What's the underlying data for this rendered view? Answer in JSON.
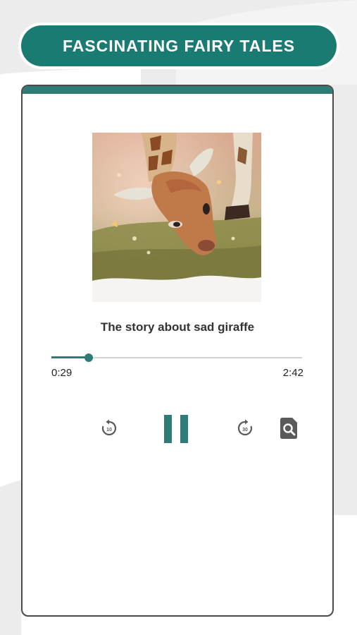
{
  "header": {
    "title": "FASCINATING FAIRY TALES"
  },
  "player": {
    "cover": {
      "subject": "giraffe illustration"
    },
    "story_title": "The story about sad giraffe",
    "progress_fraction": 0.15,
    "time_current": "0:29",
    "time_total": "2:42",
    "controls": {
      "rewind_seconds": "10",
      "forward_seconds": "30",
      "rewind_icon": "replay-10-icon",
      "pause_icon": "pause-icon",
      "forward_icon": "forward-30-icon",
      "search_icon": "document-search-icon"
    }
  },
  "colors": {
    "accent": "#2f7b77",
    "title_bg": "#1a7b73",
    "icon_grey": "#5a5a5a"
  }
}
